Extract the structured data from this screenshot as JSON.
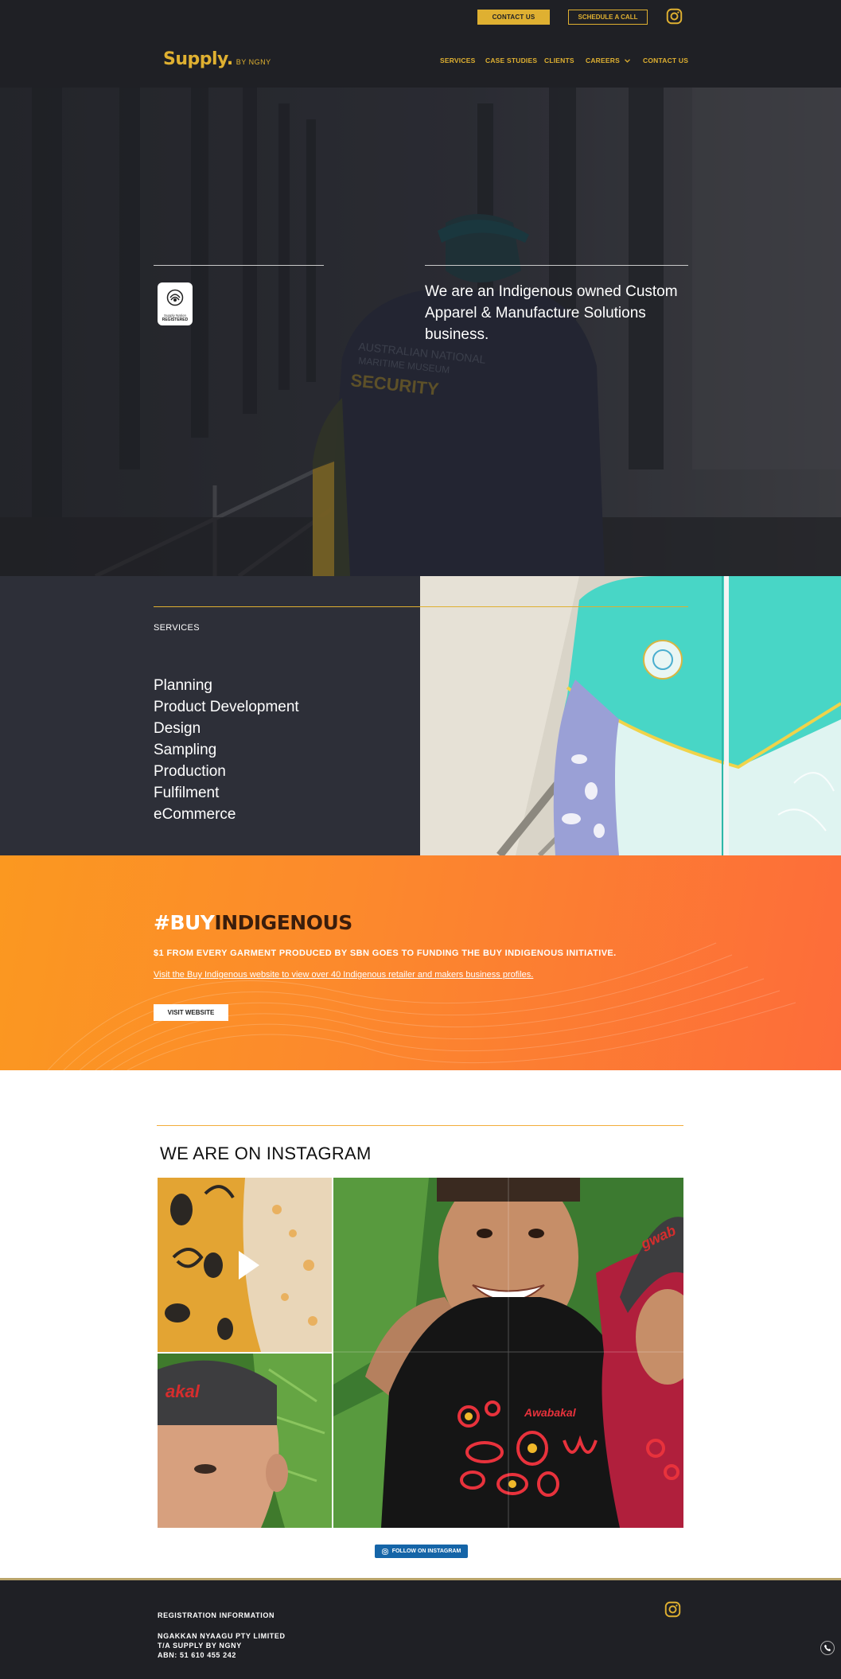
{
  "topbar": {
    "contact_label": "CONTACT US",
    "schedule_label": "SCHEDULE A CALL"
  },
  "brand": {
    "name": "Supply.",
    "sub": "BY NGNY"
  },
  "nav": {
    "items": [
      "SERVICES",
      "CASE STUDIES",
      "CLIENTS",
      "CAREERS",
      "CONTACT US"
    ]
  },
  "hero": {
    "badge_line1": "Supply Nation",
    "badge_line2": "REGISTERED",
    "tagline": "We are an Indigenous owned Custom Apparel & Manufacture Solutions business."
  },
  "services": {
    "title": "SERVICES",
    "items": [
      "Planning",
      "Product Development",
      "Design",
      "Sampling",
      "Production",
      "Fulfilment",
      "eCommerce"
    ]
  },
  "buy_indigenous": {
    "hash": "#BUY",
    "word": "INDIGENOUS",
    "line1": "$1 FROM EVERY GARMENT PRODUCED BY SBN GOES TO FUNDING THE BUY INDIGENOUS INITIATIVE.",
    "line2": "Visit the Buy Indigenous website to view over 40 Indigenous retailer and makers business profiles.",
    "button_label": "VISIT WEBSITE"
  },
  "instagram": {
    "heading": "WE ARE ON INSTAGRAM",
    "follow_label": "FOLLOW ON INSTAGRAM",
    "shirt_text": "Awabakal",
    "cap_text": "akal"
  },
  "footer": {
    "heading": "REGISTRATION INFORMATION",
    "company": "NGAKKAN NYAAGU PTY LIMITED",
    "trading_as": "T/A SUPPLY BY NGNY",
    "abn": "ABN: 51 610 455 242"
  },
  "colors": {
    "brand_gold": "#dfb031",
    "dark": "#1f2025",
    "services_bg": "#2d2f38",
    "orange": "#fc8a2c",
    "follow_blue": "#1565a8"
  }
}
